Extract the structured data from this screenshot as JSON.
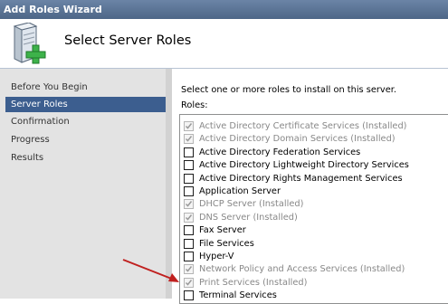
{
  "window": {
    "title": "Add Roles Wizard"
  },
  "header": {
    "title": "Select Server Roles",
    "icon": "server-add-icon"
  },
  "nav": {
    "items": [
      {
        "label": "Before You Begin",
        "selected": false
      },
      {
        "label": "Server Roles",
        "selected": true
      },
      {
        "label": "Confirmation",
        "selected": false
      },
      {
        "label": "Progress",
        "selected": false
      },
      {
        "label": "Results",
        "selected": false
      }
    ]
  },
  "content": {
    "instruction": "Select one or more roles to install on this server.",
    "roles_label": "Roles:",
    "roles": [
      {
        "label": "Active Directory Certificate Services  (Installed)",
        "checked": true,
        "installed": true
      },
      {
        "label": "Active Directory Domain Services  (Installed)",
        "checked": true,
        "installed": true
      },
      {
        "label": "Active Directory Federation Services",
        "checked": false,
        "installed": false
      },
      {
        "label": "Active Directory Lightweight Directory Services",
        "checked": false,
        "installed": false
      },
      {
        "label": "Active Directory Rights Management Services",
        "checked": false,
        "installed": false
      },
      {
        "label": "Application Server",
        "checked": false,
        "installed": false
      },
      {
        "label": "DHCP Server  (Installed)",
        "checked": true,
        "installed": true
      },
      {
        "label": "DNS Server  (Installed)",
        "checked": true,
        "installed": true
      },
      {
        "label": "Fax Server",
        "checked": false,
        "installed": false
      },
      {
        "label": "File Services",
        "checked": false,
        "installed": false
      },
      {
        "label": "Hyper-V",
        "checked": false,
        "installed": false
      },
      {
        "label": "Network Policy and Access Services  (Installed)",
        "checked": true,
        "installed": true
      },
      {
        "label": "Print Services  (Installed)",
        "checked": true,
        "installed": true
      },
      {
        "label": "Terminal Services",
        "checked": false,
        "installed": false
      }
    ]
  },
  "colors": {
    "accent": "#3c5e8f",
    "arrow": "#c0201f",
    "installed_text": "#888888"
  }
}
